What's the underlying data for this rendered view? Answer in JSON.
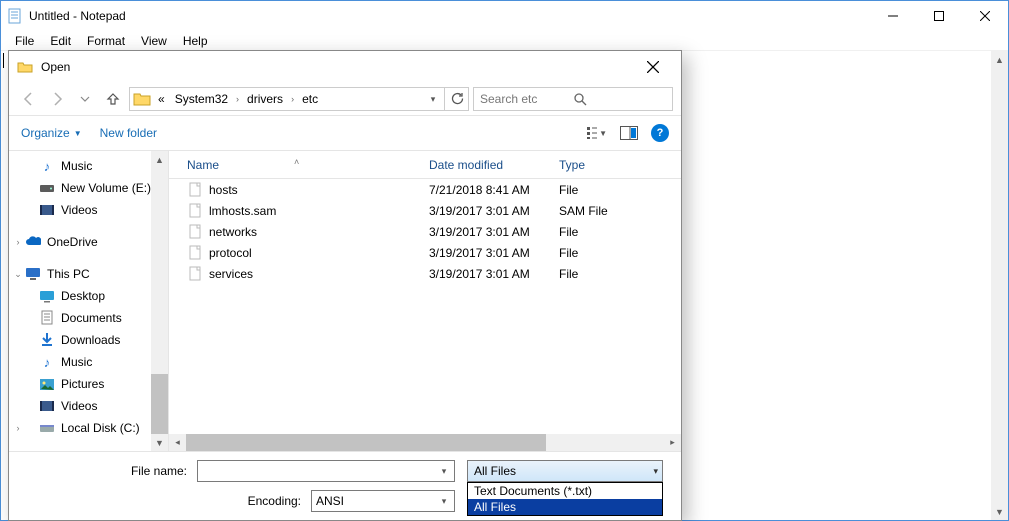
{
  "window": {
    "title": "Untitled - Notepad"
  },
  "menubar": {
    "file": "File",
    "edit": "Edit",
    "format": "Format",
    "view": "View",
    "help": "Help"
  },
  "dialog": {
    "title": "Open",
    "breadcrumbs": {
      "prefix": "«",
      "seg1": "System32",
      "seg2": "drivers",
      "seg3": "etc"
    },
    "search_placeholder": "Search etc",
    "organize": "Organize",
    "new_folder": "New folder",
    "tree": {
      "music1": "Music",
      "newvol": "New Volume (E:)",
      "videos1": "Videos",
      "onedrive": "OneDrive",
      "thispc": "This PC",
      "desktop": "Desktop",
      "documents": "Documents",
      "downloads": "Downloads",
      "music2": "Music",
      "pictures": "Pictures",
      "videos2": "Videos",
      "localdisk": "Local Disk (C:)"
    },
    "columns": {
      "name": "Name",
      "date": "Date modified",
      "type": "Type"
    },
    "files": [
      {
        "name": "hosts",
        "date": "7/21/2018 8:41 AM",
        "type": "File"
      },
      {
        "name": "lmhosts.sam",
        "date": "3/19/2017 3:01 AM",
        "type": "SAM File"
      },
      {
        "name": "networks",
        "date": "3/19/2017 3:01 AM",
        "type": "File"
      },
      {
        "name": "protocol",
        "date": "3/19/2017 3:01 AM",
        "type": "File"
      },
      {
        "name": "services",
        "date": "3/19/2017 3:01 AM",
        "type": "File"
      }
    ],
    "filename_label": "File name:",
    "filename_value": "",
    "encoding_label": "Encoding:",
    "encoding_value": "ANSI",
    "filter_selected": "All Files",
    "filter_options": {
      "txt": "Text Documents (*.txt)",
      "all": "All Files"
    }
  }
}
